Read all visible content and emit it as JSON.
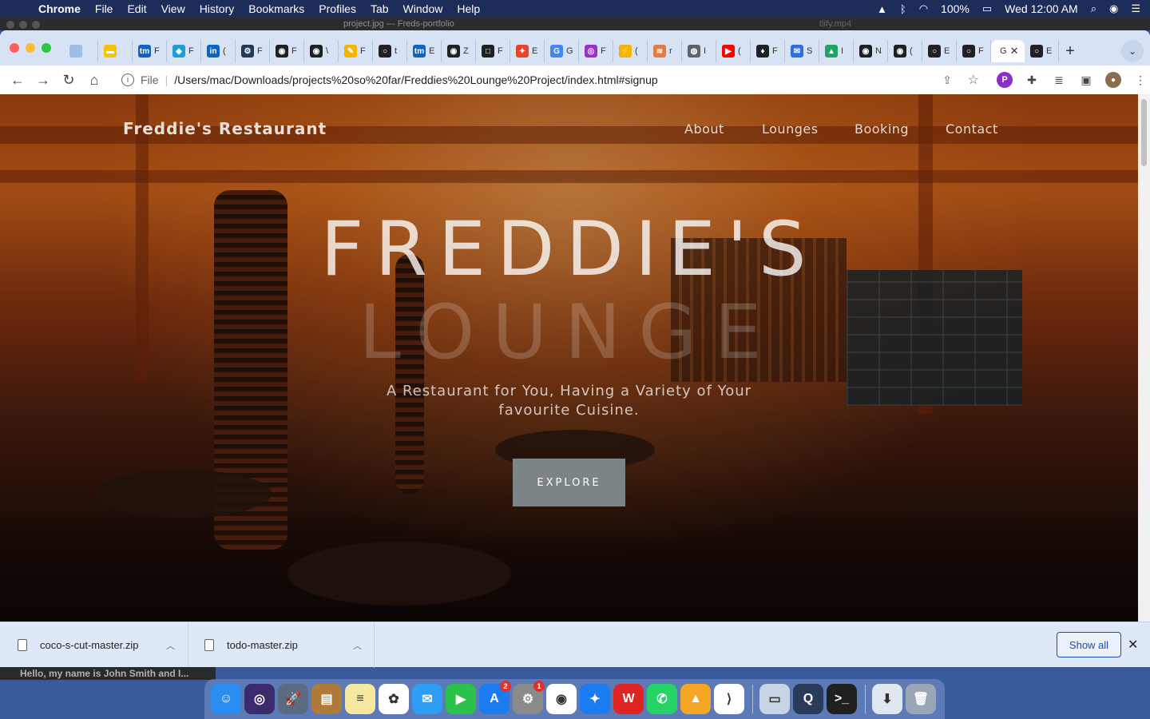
{
  "menubar": {
    "app": "Chrome",
    "items": [
      "File",
      "Edit",
      "View",
      "History",
      "Bookmarks",
      "Profiles",
      "Tab",
      "Window",
      "Help"
    ],
    "battery": "100%",
    "clock": "Wed 12:00 AM"
  },
  "background_window": {
    "title": "project.jpg — Freds-portfolio",
    "right_text": "tlify.mp4"
  },
  "browser": {
    "tabs": [
      {
        "fav_color": "#9cc0e8",
        "fav_text": "",
        "letter": ""
      },
      {
        "fav_color": "#f5c400",
        "fav_text": "▬",
        "letter": ""
      },
      {
        "fav_color": "#0e63c8",
        "fav_text": "tm",
        "letter": "F"
      },
      {
        "fav_color": "#1a9fd6",
        "fav_text": "◆",
        "letter": "F"
      },
      {
        "fav_color": "#0a66c2",
        "fav_text": "in",
        "letter": "("
      },
      {
        "fav_color": "#1f3a5a",
        "fav_text": "⚙",
        "letter": "F"
      },
      {
        "fav_color": "#202124",
        "fav_text": "◉",
        "letter": "F"
      },
      {
        "fav_color": "#202124",
        "fav_text": "◉",
        "letter": "\\"
      },
      {
        "fav_color": "#f5b400",
        "fav_text": "✎",
        "letter": "F"
      },
      {
        "fav_color": "#202124",
        "fav_text": "○",
        "letter": "t"
      },
      {
        "fav_color": "#0e63c8",
        "fav_text": "tm",
        "letter": "E"
      },
      {
        "fav_color": "#202124",
        "fav_text": "◉",
        "letter": "Z"
      },
      {
        "fav_color": "#202124",
        "fav_text": "□",
        "letter": "F"
      },
      {
        "fav_color": "#e8442a",
        "fav_text": "✦",
        "letter": "E"
      },
      {
        "fav_color": "#4285f4",
        "fav_text": "G",
        "letter": "G"
      },
      {
        "fav_color": "#9b30c9",
        "fav_text": "◎",
        "letter": "F"
      },
      {
        "fav_color": "#f5b400",
        "fav_text": "⚡",
        "letter": "("
      },
      {
        "fav_color": "#e37b43",
        "fav_text": "≋",
        "letter": "r"
      },
      {
        "fav_color": "#5f6368",
        "fav_text": "◍",
        "letter": "I"
      },
      {
        "fav_color": "#ff0000",
        "fav_text": "▶",
        "letter": "("
      },
      {
        "fav_color": "#202124",
        "fav_text": "♦",
        "letter": "F"
      },
      {
        "fav_color": "#2d6ee6",
        "fav_text": "✉",
        "letter": "S"
      },
      {
        "fav_color": "#1fa463",
        "fav_text": "▲",
        "letter": "I"
      },
      {
        "fav_color": "#202124",
        "fav_text": "◉",
        "letter": "N"
      },
      {
        "fav_color": "#202124",
        "fav_text": "◉",
        "letter": "("
      },
      {
        "fav_color": "#202124",
        "fav_text": "○",
        "letter": "E"
      },
      {
        "fav_color": "#202124",
        "fav_text": "○",
        "letter": "F"
      }
    ],
    "active_tab": {
      "letter": "G",
      "close": "✕"
    },
    "last_tab": {
      "fav_color": "#202124",
      "fav_text": "○",
      "letter": "E"
    },
    "address": {
      "scheme": "File",
      "url": "/Users/mac/Downloads/projects%20so%20far/Freddies%20Lounge%20Project/index.html#signup"
    }
  },
  "site": {
    "brand": "Freddie's Restaurant",
    "nav": [
      "About",
      "Lounges",
      "Booking",
      "Contact"
    ],
    "hero_title": "FREDDIE'S",
    "hero_sub": "LOUNGE",
    "tagline_line1": "A Restaurant for You, Having a Variety of Your",
    "tagline_line2": "favourite Cuisine.",
    "cta": "EXPLORE"
  },
  "downloads": {
    "items": [
      "coco-s-cut-master.zip",
      "todo-master.zip"
    ],
    "show_all": "Show all"
  },
  "behind_window_text": "Hello, my name is John Smith and I...",
  "dock": {
    "apps": [
      {
        "name": "finder",
        "color": "#2a8df0",
        "glyph": "☺"
      },
      {
        "name": "siri",
        "color": "#3b2a6e",
        "glyph": "◎"
      },
      {
        "name": "launchpad",
        "color": "#5a6a80",
        "glyph": "🚀"
      },
      {
        "name": "notes-book",
        "color": "#b07a3a",
        "glyph": "▤"
      },
      {
        "name": "notes",
        "color": "#f5e9a0",
        "glyph": "≡"
      },
      {
        "name": "photos",
        "color": "#ffffff",
        "glyph": "✿"
      },
      {
        "name": "messages",
        "color": "#2d9df5",
        "glyph": "✉"
      },
      {
        "name": "facetime",
        "color": "#2ac24a",
        "glyph": "▶"
      },
      {
        "name": "app-store",
        "color": "#1a7cf0",
        "glyph": "A",
        "badge": "2"
      },
      {
        "name": "system-preferences",
        "color": "#8a8a8a",
        "glyph": "⚙",
        "badge": "1"
      },
      {
        "name": "chrome",
        "color": "#ffffff",
        "glyph": "◉"
      },
      {
        "name": "safari",
        "color": "#1a7cf0",
        "glyph": "✦"
      },
      {
        "name": "wps",
        "color": "#e02424",
        "glyph": "W"
      },
      {
        "name": "whatsapp",
        "color": "#25d366",
        "glyph": "✆"
      },
      {
        "name": "vlc",
        "color": "#f5a623",
        "glyph": "▲"
      },
      {
        "name": "vscode",
        "color": "#ffffff",
        "glyph": "⟩"
      },
      {
        "name": "preview",
        "color": "#c8d4e4",
        "glyph": "▭"
      },
      {
        "name": "quicktime",
        "color": "#2a3a5a",
        "glyph": "Q"
      },
      {
        "name": "terminal",
        "color": "#202020",
        "glyph": ">_"
      },
      {
        "name": "downloads-stack",
        "color": "#dfe6ef",
        "glyph": "⬇"
      },
      {
        "name": "trash",
        "color": "#9aa6b6",
        "glyph": "🗑"
      }
    ]
  }
}
